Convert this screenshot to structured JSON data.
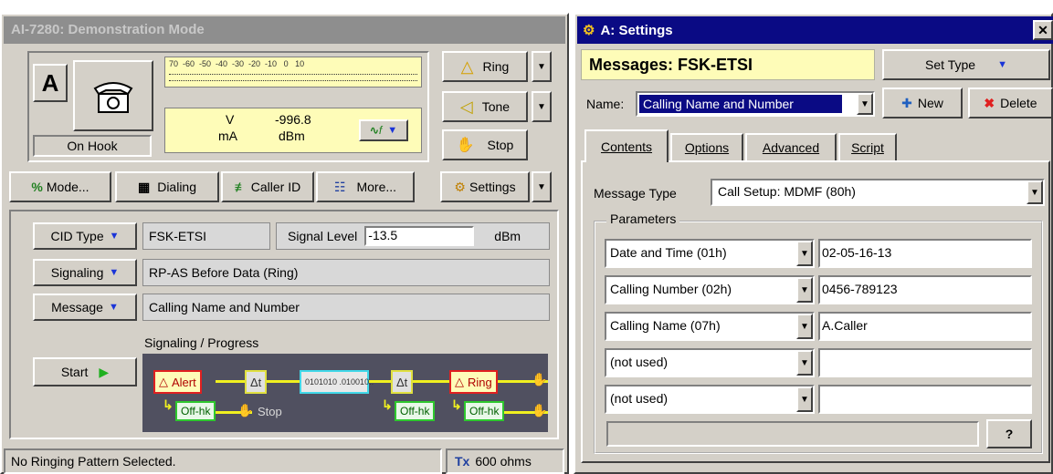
{
  "left_window": {
    "title": "AI-7280:  Demonstration Mode",
    "line_letter": "A",
    "hook_status": "On Hook",
    "meter": {
      "scale": "70  -60  -50  -40  -30  -20  -10   0   10",
      "unit_top": "V",
      "unit_bottom": "mA",
      "level_value": "-996.8",
      "level_unit": "dBm",
      "freq_label": "f"
    },
    "right_buttons": {
      "ring": "Ring",
      "tone": "Tone",
      "stop": "Stop",
      "settings": "Settings"
    },
    "toolbar": {
      "mode": "Mode...",
      "dialing": "Dialing",
      "caller_id": "Caller ID",
      "more": "More..."
    },
    "cid": {
      "cid_type_label": "CID Type",
      "cid_type_value": "FSK-ETSI",
      "signal_level_label": "Signal Level",
      "signal_level_value": "-13.5",
      "signal_level_unit": "dBm",
      "signaling_label": "Signaling",
      "signaling_value": "RP-AS Before Data (Ring)",
      "message_label": "Message",
      "message_value": "Calling Name and Number",
      "progress_label": "Signaling / Progress",
      "start_label": "Start"
    },
    "flow": {
      "alert": "Alert",
      "dt1": "Δt",
      "data": "0101010 .010010..",
      "dt2": "Δt",
      "ring": "Ring",
      "offhk1": "Off-hk",
      "stop": "Stop",
      "offhk2": "Off-hk",
      "offhk3": "Off-hk"
    },
    "status": {
      "message": "No Ringing Pattern Selected.",
      "impedance": "600 ohms",
      "impedance_icon_text": "Tx"
    }
  },
  "right_window": {
    "title": "A:  Settings",
    "messages_label": "Messages: FSK-ETSI",
    "set_type": "Set Type",
    "name_label": "Name:",
    "name_value": "Calling Name and Number",
    "new_button": "New",
    "delete_button": "Delete",
    "tabs": [
      "Contents",
      "Options",
      "Advanced",
      "Script"
    ],
    "message_type_label": "Message Type",
    "message_type_value": "Call Setup: MDMF (80h)",
    "parameters_label": "Parameters",
    "parameters": [
      {
        "type": "Date and Time (01h)",
        "value": "02-05-16-13"
      },
      {
        "type": "Calling Number (02h)",
        "value": "0456-789123"
      },
      {
        "type": "Calling Name (07h)",
        "value": "A.Caller"
      },
      {
        "type": "(not used)",
        "value": ""
      },
      {
        "type": "(not used)",
        "value": ""
      }
    ],
    "help_button": "?"
  },
  "colors": {
    "title_active": "#0a0a84",
    "title_inactive": "#8e8e8e",
    "meter_yellow": "#fefcb8",
    "alert_red": "#e02020",
    "offhook_green": "#2ec82e",
    "data_cyan": "#40d8e8"
  }
}
